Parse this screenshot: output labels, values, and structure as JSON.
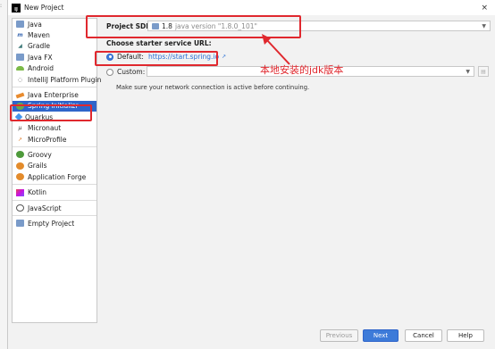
{
  "window": {
    "title": "New Project",
    "close": "×"
  },
  "sidebar": {
    "items": [
      {
        "label": "Java",
        "icon": "folder-icon"
      },
      {
        "label": "Maven",
        "icon": "maven-icon"
      },
      {
        "label": "Gradle",
        "icon": "gradle-icon"
      },
      {
        "label": "Java FX",
        "icon": "folder-icon"
      },
      {
        "label": "Android",
        "icon": "android-icon"
      },
      {
        "label": "IntelliJ Platform Plugin",
        "icon": "plugin-icon"
      },
      {
        "label": "Java Enterprise",
        "icon": "java-enterprise-icon"
      },
      {
        "label": "Spring Initializr",
        "icon": "spring-icon"
      },
      {
        "label": "Quarkus",
        "icon": "quarkus-icon"
      },
      {
        "label": "Micronaut",
        "icon": "micronaut-icon"
      },
      {
        "label": "MicroProfile",
        "icon": "microprofile-icon"
      },
      {
        "label": "Groovy",
        "icon": "groovy-icon"
      },
      {
        "label": "Grails",
        "icon": "grails-icon"
      },
      {
        "label": "Application Forge",
        "icon": "application-forge-icon"
      },
      {
        "label": "Kotlin",
        "icon": "kotlin-icon"
      },
      {
        "label": "JavaScript",
        "icon": "javascript-icon"
      },
      {
        "label": "Empty Project",
        "icon": "folder-icon"
      }
    ],
    "selected": "Spring Initializr"
  },
  "main": {
    "sdk_label": "Project SDK:",
    "sdk_value": "1.8",
    "sdk_version": "java version \"1.8.0_101\"",
    "service_url_label": "Choose starter service URL:",
    "default_label": "Default:",
    "default_url": "https://start.spring.io",
    "default_url_arrow": "↗",
    "custom_label": "Custom:",
    "custom_value": "",
    "hint": "Make sure your network connection is active before continuing."
  },
  "annotation": {
    "text": "本地安装的jdk版本",
    "color": "#e0282e"
  },
  "buttons": {
    "previous": "Previous",
    "next": "Next",
    "cancel": "Cancel",
    "help": "Help"
  },
  "colors": {
    "accent": "#2f65ca",
    "highlight": "#e0282e"
  }
}
